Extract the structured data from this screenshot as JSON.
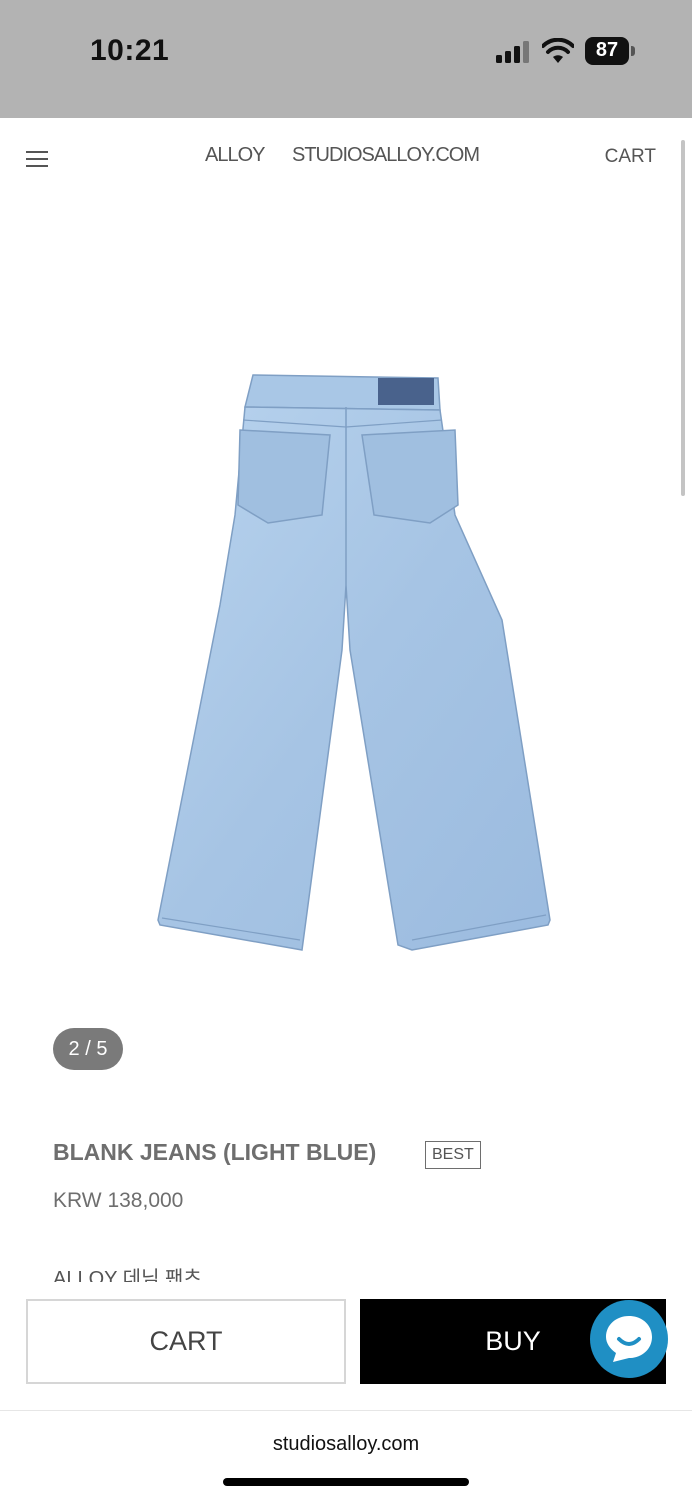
{
  "status_bar": {
    "time": "10:21",
    "battery": "87"
  },
  "header": {
    "brand": "ALLOY",
    "site": "STUDIOSALLOY.COM",
    "cart": "CART"
  },
  "product": {
    "image_counter": "2 / 5",
    "title": "BLANK JEANS (LIGHT BLUE)",
    "badge": "BEST",
    "price": "KRW 138,000",
    "description": "ALLOY 데님 팬츠"
  },
  "actions": {
    "cart_label": "CART",
    "buy_label": "BUY"
  },
  "browser": {
    "url": "studiosalloy.com"
  },
  "colors": {
    "denim": "#a9c8e6",
    "chat": "#1f8fc4",
    "buy_bg": "#000000"
  }
}
